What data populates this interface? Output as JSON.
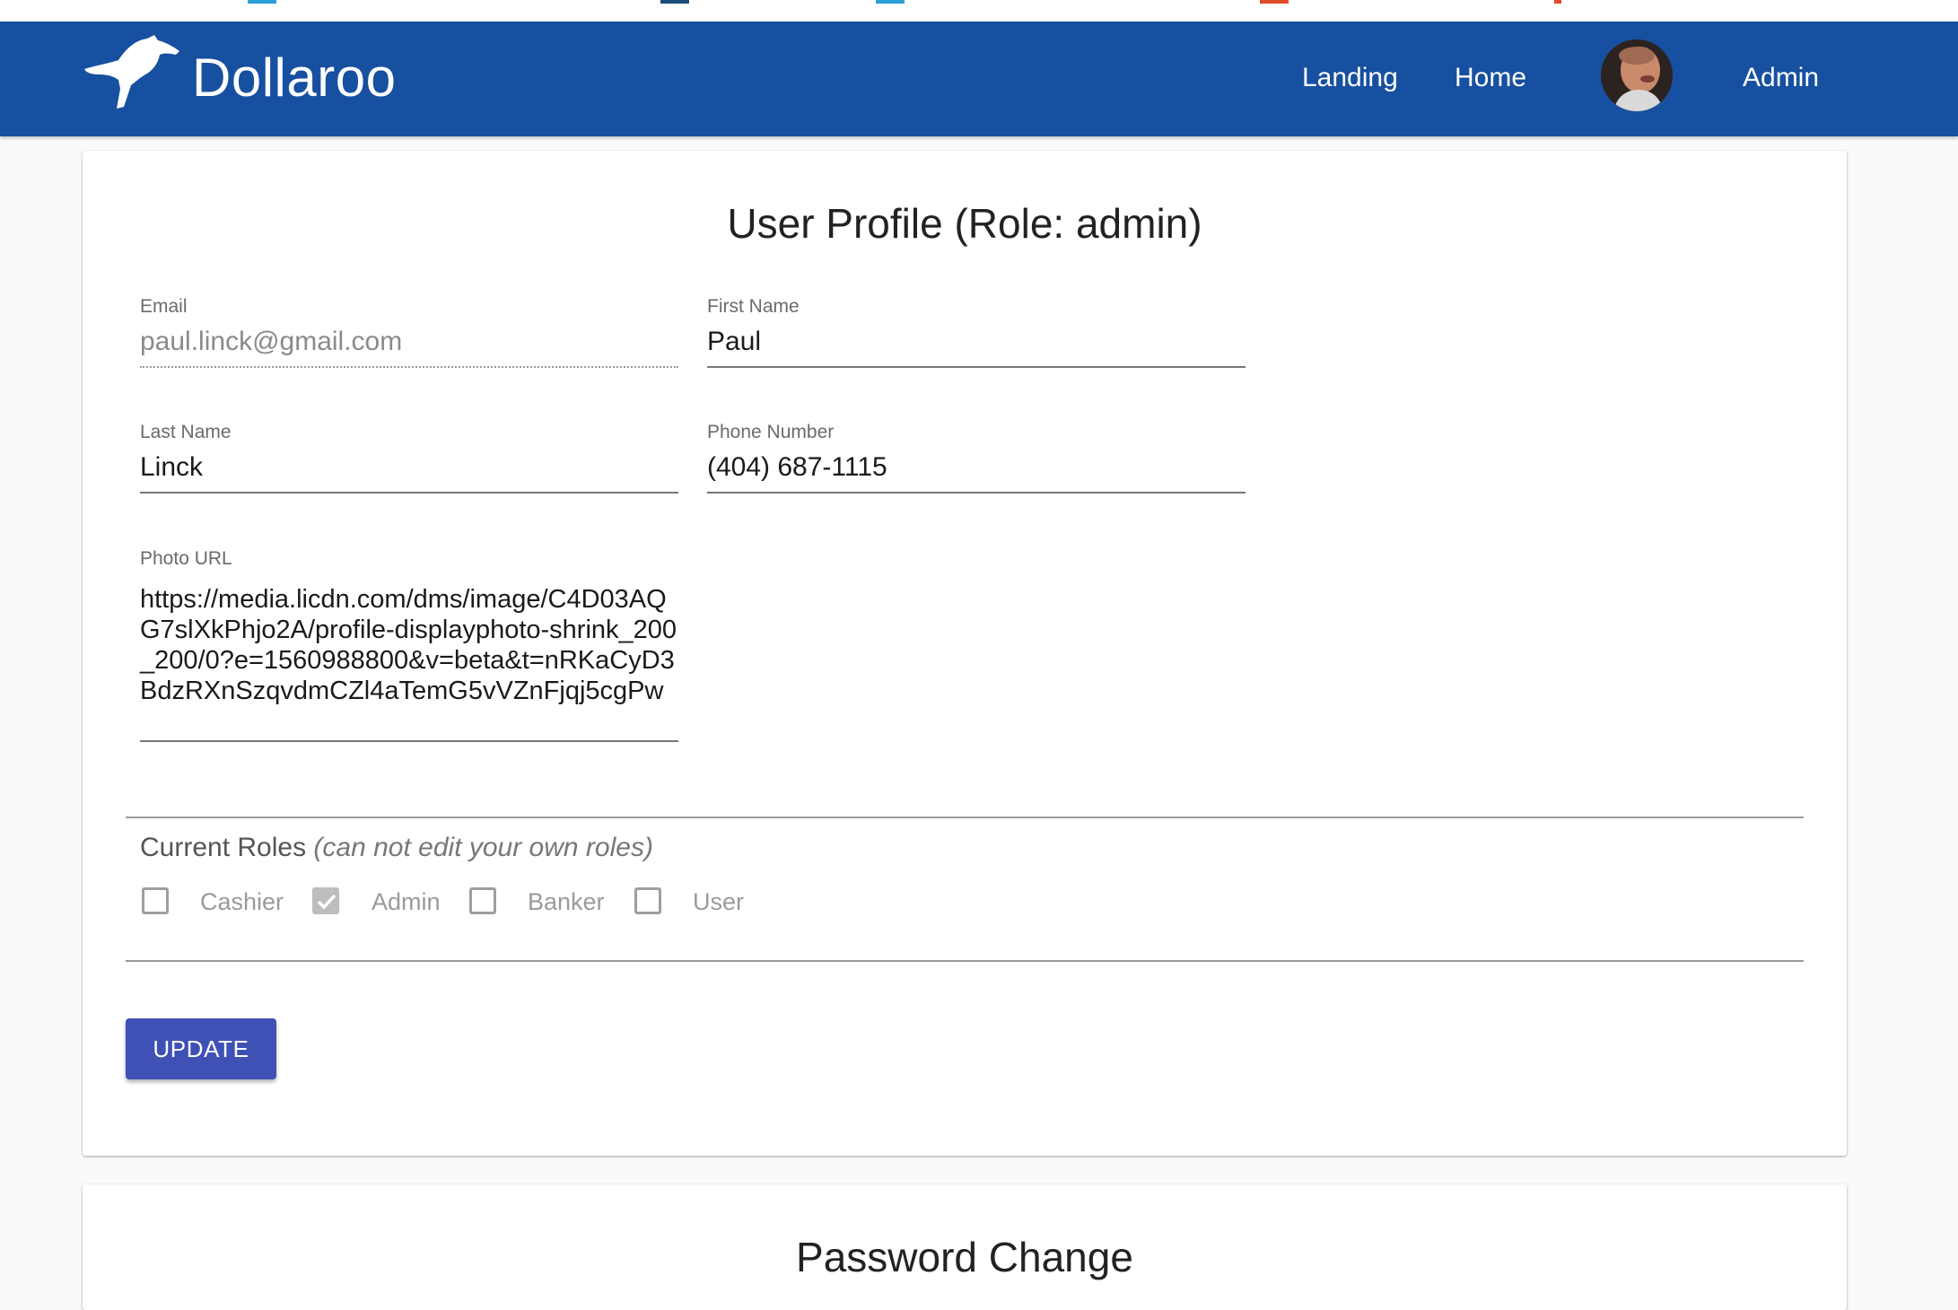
{
  "app": {
    "brand": "Dollaroo"
  },
  "nav": {
    "landing": "Landing",
    "home": "Home",
    "admin": "Admin"
  },
  "colors": {
    "appbar": "#1750a0",
    "button": "#3f51b5"
  },
  "profile": {
    "title": "User Profile (Role: admin)",
    "email": {
      "label": "Email",
      "value": "paul.linck@gmail.com"
    },
    "first_name": {
      "label": "First Name",
      "value": "Paul"
    },
    "last_name": {
      "label": "Last Name",
      "value": "Linck"
    },
    "phone": {
      "label": "Phone Number",
      "value": "(404) 687-1115"
    },
    "photo_url": {
      "label": "Photo URL",
      "value": "https://media.licdn.com/dms/image/C4D03AQG7slXkPhjo2A/profile-displayphoto-shrink_200_200/0?e=1560988800&v=beta&t=nRKaCyD3BdzRXnSzqvdmCZl4aTemG5vVZnFjqj5cgPw"
    },
    "roles": {
      "heading": "Current Roles",
      "note": "(can not edit your own roles)",
      "options": [
        {
          "label": "Cashier",
          "checked": false
        },
        {
          "label": "Admin",
          "checked": true
        },
        {
          "label": "Banker",
          "checked": false
        },
        {
          "label": "User",
          "checked": false
        }
      ]
    },
    "update_label": "UPDATE"
  },
  "password": {
    "title": "Password Change"
  }
}
